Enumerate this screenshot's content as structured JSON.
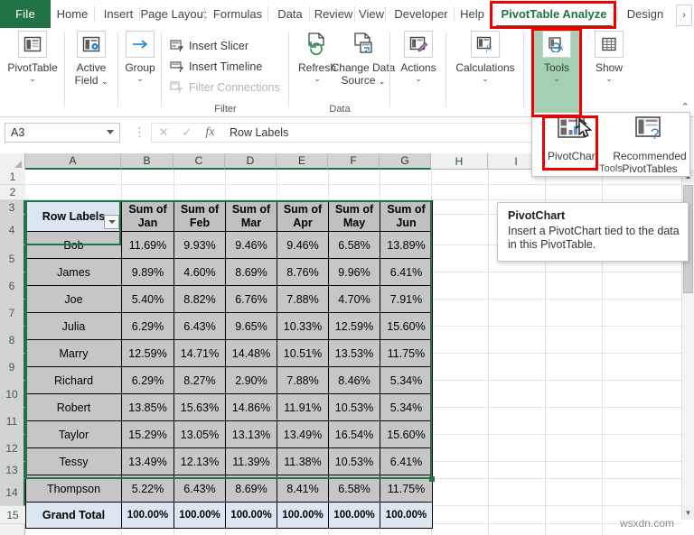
{
  "ribbon": {
    "file_tab": "File",
    "tabs": [
      {
        "label": "Home",
        "active": false
      },
      {
        "label": "Insert",
        "active": false
      },
      {
        "label": "Page Layout",
        "active": false
      },
      {
        "label": "Formulas",
        "active": false
      },
      {
        "label": "Data",
        "active": false
      },
      {
        "label": "Review",
        "active": false
      },
      {
        "label": "View",
        "active": false
      },
      {
        "label": "Developer",
        "active": false
      },
      {
        "label": "Help",
        "active": false
      },
      {
        "label": "PivotTable Analyze",
        "active": true
      },
      {
        "label": "Design",
        "active": false
      }
    ],
    "overflow_label": "›",
    "collapse_label": "⌃",
    "groups": [
      {
        "name": "pivottable-group",
        "label": "",
        "buttons": [
          {
            "label": "PivotTable",
            "icon": "pivottable-icon",
            "caret": "⌄"
          }
        ]
      },
      {
        "name": "active-field-group",
        "label": "",
        "buttons": [
          {
            "label": "Active\nField",
            "icon": "active-field-icon",
            "caret": "⌄"
          }
        ]
      },
      {
        "name": "group-group",
        "label": "",
        "buttons": [
          {
            "label": "Group",
            "icon": "group-arrow-icon",
            "caret": "⌄"
          }
        ]
      },
      {
        "name": "filter-group",
        "label": "Filter",
        "items": [
          {
            "label": "Insert Slicer",
            "icon": "slicer-icon",
            "disabled": false
          },
          {
            "label": "Insert Timeline",
            "icon": "timeline-icon",
            "disabled": false
          },
          {
            "label": "Filter Connections",
            "icon": "filter-connections-icon",
            "disabled": true
          }
        ]
      },
      {
        "name": "data-group",
        "label": "Data",
        "buttons": [
          {
            "label": "Refresh",
            "icon": "refresh-icon",
            "caret": "⌄"
          },
          {
            "label": "Change Data\nSource",
            "icon": "change-data-source-icon",
            "caret": "⌄"
          }
        ]
      },
      {
        "name": "actions-group",
        "label": "",
        "buttons": [
          {
            "label": "Actions",
            "icon": "actions-icon",
            "caret": "⌄"
          }
        ]
      },
      {
        "name": "calculations-group",
        "label": "",
        "buttons": [
          {
            "label": "Calculations",
            "icon": "calculations-icon",
            "caret": "⌄"
          }
        ]
      },
      {
        "name": "tools-group",
        "label": "",
        "highlighted": true,
        "buttons": [
          {
            "label": "Tools",
            "icon": "tools-fx-icon",
            "caret": "⌄"
          }
        ]
      },
      {
        "name": "show-group",
        "label": "",
        "buttons": [
          {
            "label": "Show",
            "icon": "show-icon",
            "caret": "⌄"
          }
        ]
      }
    ]
  },
  "tools_panel": {
    "group_label": "Tools",
    "items": [
      {
        "label": "PivotChart",
        "icon": "pivotchart-icon",
        "selected": true
      },
      {
        "label": "Recommended\nPivotTables",
        "icon": "recommended-pivottables-icon",
        "selected": false
      }
    ]
  },
  "tooltip": {
    "title": "PivotChart",
    "body": "Insert a PivotChart tied to the data in this PivotTable."
  },
  "formula_bar": {
    "name_box": "A3",
    "cancel_icon": "✕",
    "confirm_icon": "✓",
    "fx_label": "fx",
    "value": "Row Labels"
  },
  "grid": {
    "columns": [
      "A",
      "B",
      "C",
      "D",
      "E",
      "F",
      "G",
      "H",
      "I"
    ],
    "selected_columns": [
      "A",
      "B",
      "C",
      "D",
      "E",
      "F",
      "G"
    ],
    "rows": [
      "1",
      "2",
      "3",
      "4",
      "5",
      "6",
      "7",
      "8",
      "9",
      "10",
      "11",
      "12",
      "13",
      "14",
      "15"
    ],
    "selected_rows": [
      "3",
      "4",
      "5",
      "6",
      "7",
      "8",
      "9",
      "10",
      "11",
      "12",
      "13",
      "14"
    ]
  },
  "pivot_table": {
    "headers": [
      "Row Labels",
      "Sum of Jan",
      "Sum of Feb",
      "Sum of Mar",
      "Sum of Apr",
      "Sum of May",
      "Sum of Jun"
    ],
    "rows": [
      {
        "label": "Bob",
        "values": [
          "11.69%",
          "9.93%",
          "9.46%",
          "9.46%",
          "6.58%",
          "13.89%"
        ]
      },
      {
        "label": "James",
        "values": [
          "9.89%",
          "4.60%",
          "8.69%",
          "8.76%",
          "9.96%",
          "6.41%"
        ]
      },
      {
        "label": "Joe",
        "values": [
          "5.40%",
          "8.82%",
          "6.76%",
          "7.88%",
          "4.70%",
          "7.91%"
        ]
      },
      {
        "label": "Julia",
        "values": [
          "6.29%",
          "6.43%",
          "9.65%",
          "10.33%",
          "12.59%",
          "15.60%"
        ]
      },
      {
        "label": "Marry",
        "values": [
          "12.59%",
          "14.71%",
          "14.48%",
          "10.51%",
          "13.53%",
          "11.75%"
        ]
      },
      {
        "label": "Richard",
        "values": [
          "6.29%",
          "8.27%",
          "2.90%",
          "7.88%",
          "8.46%",
          "5.34%"
        ]
      },
      {
        "label": "Robert",
        "values": [
          "13.85%",
          "15.63%",
          "14.86%",
          "11.91%",
          "10.53%",
          "5.34%"
        ]
      },
      {
        "label": "Taylor",
        "values": [
          "15.29%",
          "13.05%",
          "13.13%",
          "13.49%",
          "16.54%",
          "15.60%"
        ]
      },
      {
        "label": "Tessy",
        "values": [
          "13.49%",
          "12.13%",
          "11.39%",
          "11.38%",
          "10.53%",
          "6.41%"
        ]
      },
      {
        "label": "Thompson",
        "values": [
          "5.22%",
          "6.43%",
          "8.69%",
          "8.41%",
          "6.58%",
          "11.75%"
        ]
      }
    ],
    "total_row": {
      "label": "Grand Total",
      "values": [
        "100.00%",
        "100.00%",
        "100.00%",
        "100.00%",
        "100.00%",
        "100.00%"
      ]
    }
  },
  "watermark": "wsxdn.com",
  "colors": {
    "excel_green": "#217346",
    "highlight_red": "#ee0000",
    "ribbon_highlight": "#a6d0b3",
    "header_blue": "#dce6f1",
    "header_gray": "#c0c0c0",
    "cell_gray": "#c6c6c6"
  }
}
